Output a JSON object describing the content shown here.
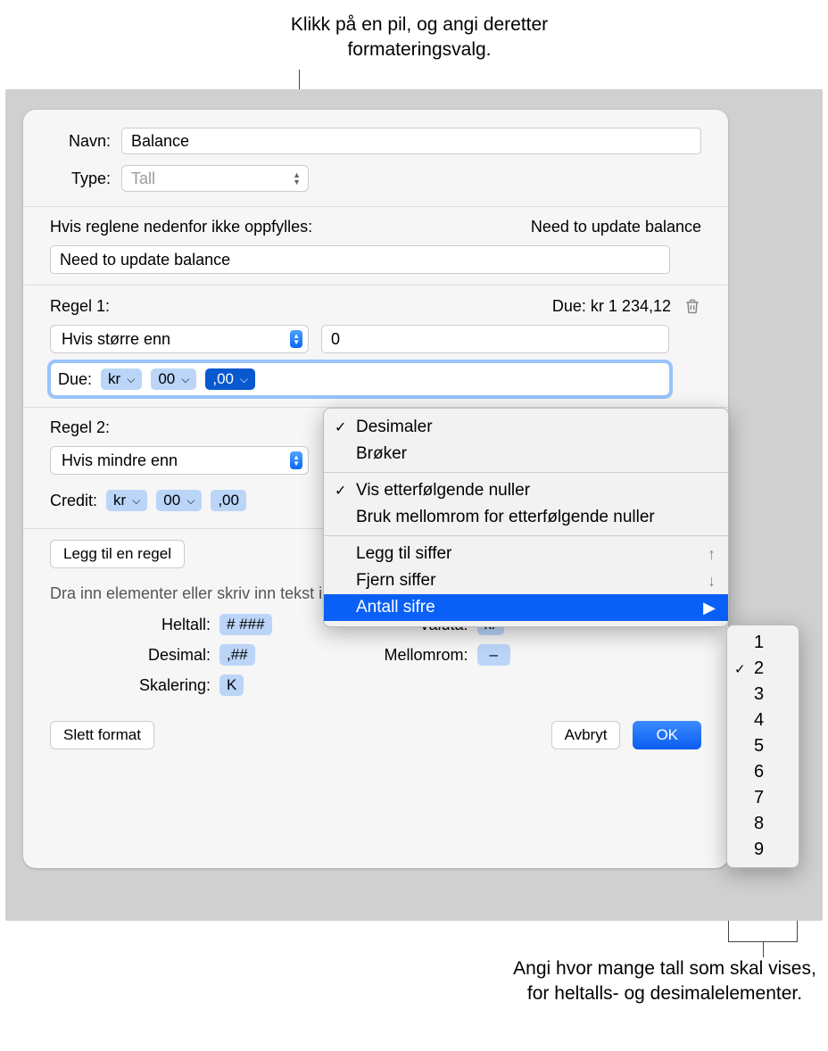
{
  "callout_top": "Klikk på en pil, og angi deretter formateringsvalg.",
  "callout_bottom": "Angi hvor mange tall som skal vises, for heltalls- og desimalelementer.",
  "labels": {
    "name": "Navn:",
    "type": "Type:",
    "rules_not_met": "Hvis reglene nedenfor ikke oppfylles:",
    "rule1": "Regel 1:",
    "rule2": "Regel 2:",
    "add_rule": "Legg til en regel",
    "drag_hint": "Dra inn elementer eller skriv inn tekst i feltet over:",
    "integer": "Heltall:",
    "decimal": "Desimal:",
    "scaling": "Skalering:",
    "currency": "Valuta:",
    "space": "Mellomrom:",
    "delete_format": "Slett format",
    "cancel": "Avbryt",
    "ok": "OK"
  },
  "values": {
    "name_value": "Balance",
    "type_value": "Tall",
    "preview_text_top": "Need to update balance",
    "condition_input": "Need to update balance",
    "rule1_preview": "Due: kr 1 234,12",
    "rule1_condition": "Hvis større enn",
    "rule1_value": "0",
    "rule1_prefix": "Due:",
    "rule2_condition": "Hvis mindre enn",
    "rule2_prefix": "Credit:"
  },
  "tokens": {
    "kr": "kr",
    "zeros": "00",
    "decimal": ",00",
    "integer_token": "# ###",
    "decimal_token": ",##",
    "scaling_token": "K",
    "currency_token": "kr",
    "space_token": "–"
  },
  "popup": {
    "decimals": "Desimaler",
    "fractions": "Brøker",
    "trailing_zeros": "Vis etterfølgende nuller",
    "space_trailing": "Bruk mellomrom for etterfølgende nuller",
    "add_digit": "Legg til siffer",
    "remove_digit": "Fjern siffer",
    "num_digits": "Antall sifre"
  },
  "submenu": [
    "1",
    "2",
    "3",
    "4",
    "5",
    "6",
    "7",
    "8",
    "9"
  ],
  "submenu_selected": "2"
}
